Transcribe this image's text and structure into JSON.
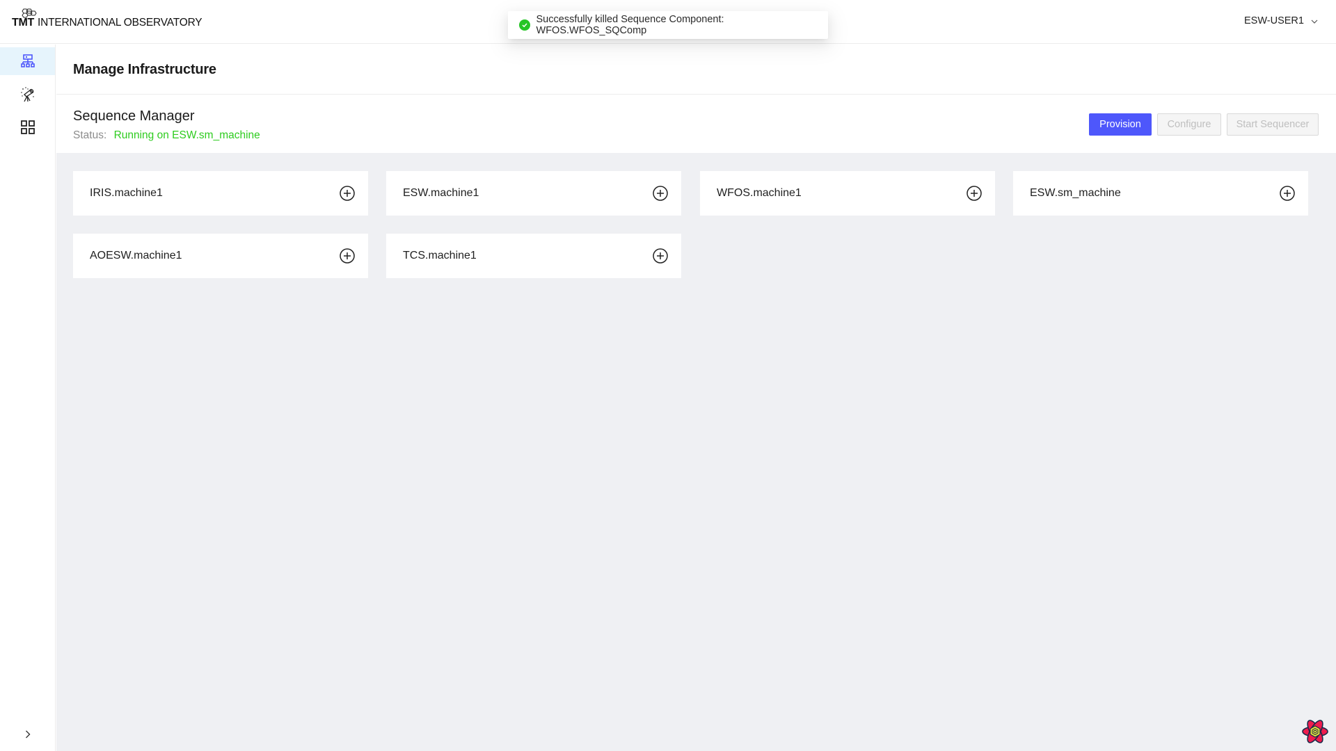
{
  "header": {
    "logo_mark": "TMT",
    "logo_text": "INTERNATIONAL OBSERVATORY",
    "user": "ESW-USER1"
  },
  "toast": {
    "type": "success",
    "message": "Successfully killed Sequence Component: WFOS.WFOS_SQComp"
  },
  "sidebar": {
    "items": [
      {
        "name": "infrastructure",
        "icon": "network-icon",
        "active": true
      },
      {
        "name": "observations",
        "icon": "telescope-icon",
        "active": false
      },
      {
        "name": "apps",
        "icon": "grid-icon",
        "active": false
      }
    ],
    "collapse_icon": "chevron-right-icon"
  },
  "page": {
    "title": "Manage Infrastructure"
  },
  "sequence_manager": {
    "title": "Sequence Manager",
    "status_label": "Status:",
    "status_value": "Running on ESW.sm_machine",
    "buttons": {
      "provision": "Provision",
      "configure": "Configure",
      "start_sequencer": "Start Sequencer"
    }
  },
  "machines": [
    {
      "name": "IRIS.machine1"
    },
    {
      "name": "ESW.machine1"
    },
    {
      "name": "WFOS.machine1"
    },
    {
      "name": "ESW.sm_machine"
    },
    {
      "name": "AOESW.machine1"
    },
    {
      "name": "TCS.machine1"
    }
  ],
  "colors": {
    "primary": "#4e57fb",
    "success": "#26c526",
    "status_running": "#2ecc1f",
    "active_nav_bg": "#e6f4fc",
    "content_bg": "#eff0f3"
  }
}
